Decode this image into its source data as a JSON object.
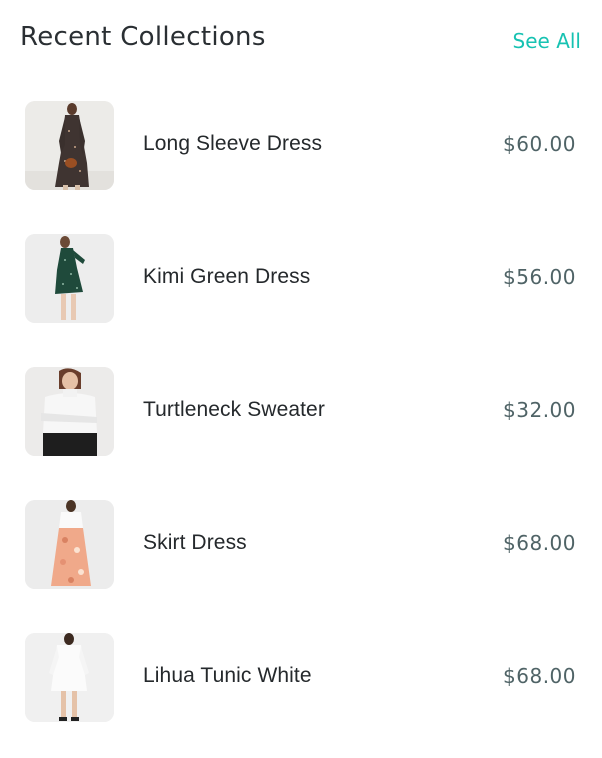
{
  "header": {
    "title": "Recent Collections",
    "see_all_label": "See All"
  },
  "colors": {
    "accent": "#17c2b2",
    "text_primary": "#25292c",
    "price_text": "#4f6366"
  },
  "products": [
    {
      "name": "Long Sleeve Dress",
      "price": "$60.00",
      "image_icon": "long-sleeve-dress-photo"
    },
    {
      "name": "Kimi Green Dress",
      "price": "$56.00",
      "image_icon": "kimi-green-dress-photo"
    },
    {
      "name": "Turtleneck Sweater",
      "price": "$32.00",
      "image_icon": "turtleneck-sweater-photo"
    },
    {
      "name": "Skirt Dress",
      "price": "$68.00",
      "image_icon": "skirt-dress-photo"
    },
    {
      "name": "Lihua Tunic White",
      "price": "$68.00",
      "image_icon": "lihua-tunic-white-photo"
    }
  ]
}
